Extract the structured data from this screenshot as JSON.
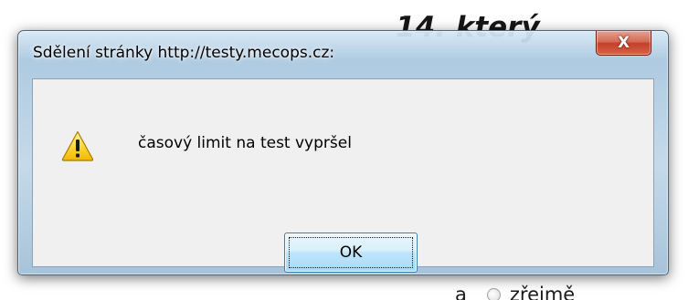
{
  "background_page": {
    "heading_fragment": "14. který",
    "option_letter": "a",
    "option_text": "zřejmě"
  },
  "dialog": {
    "title": "Sdělení stránky http://testy.mecops.cz:",
    "message": "časový limit na test vypršel",
    "ok_label": "OK",
    "close_glyph": "X",
    "icon": "warning-icon",
    "colors": {
      "frame": "#a8c6de",
      "client": "#f0f0f0",
      "close_button": "#c4402a",
      "ok_button": "#bee6fd"
    }
  }
}
